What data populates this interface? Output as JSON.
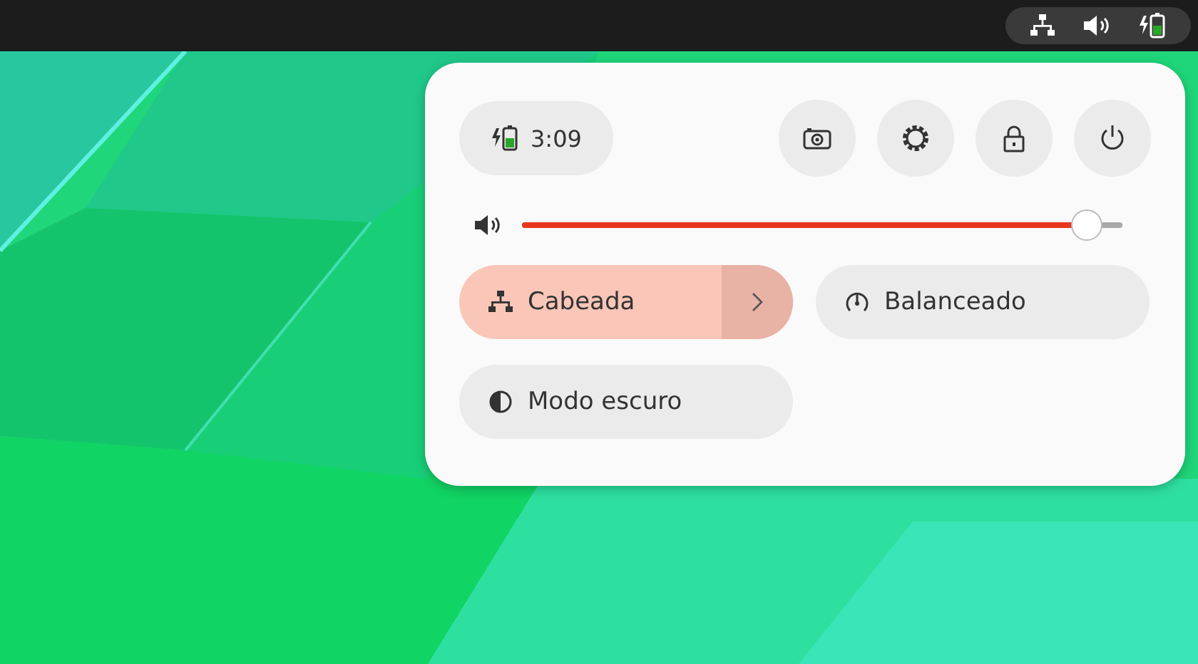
{
  "quick_settings": {
    "battery": {
      "time": "3:09"
    },
    "volume": {
      "level": 0.94
    },
    "toggles": [
      {
        "label": "Cabeada",
        "on": true,
        "has_menu": true
      },
      {
        "label": "Balanceado",
        "on": false,
        "has_menu": false
      },
      {
        "label": "Modo escuro",
        "on": false,
        "has_menu": false
      }
    ]
  }
}
